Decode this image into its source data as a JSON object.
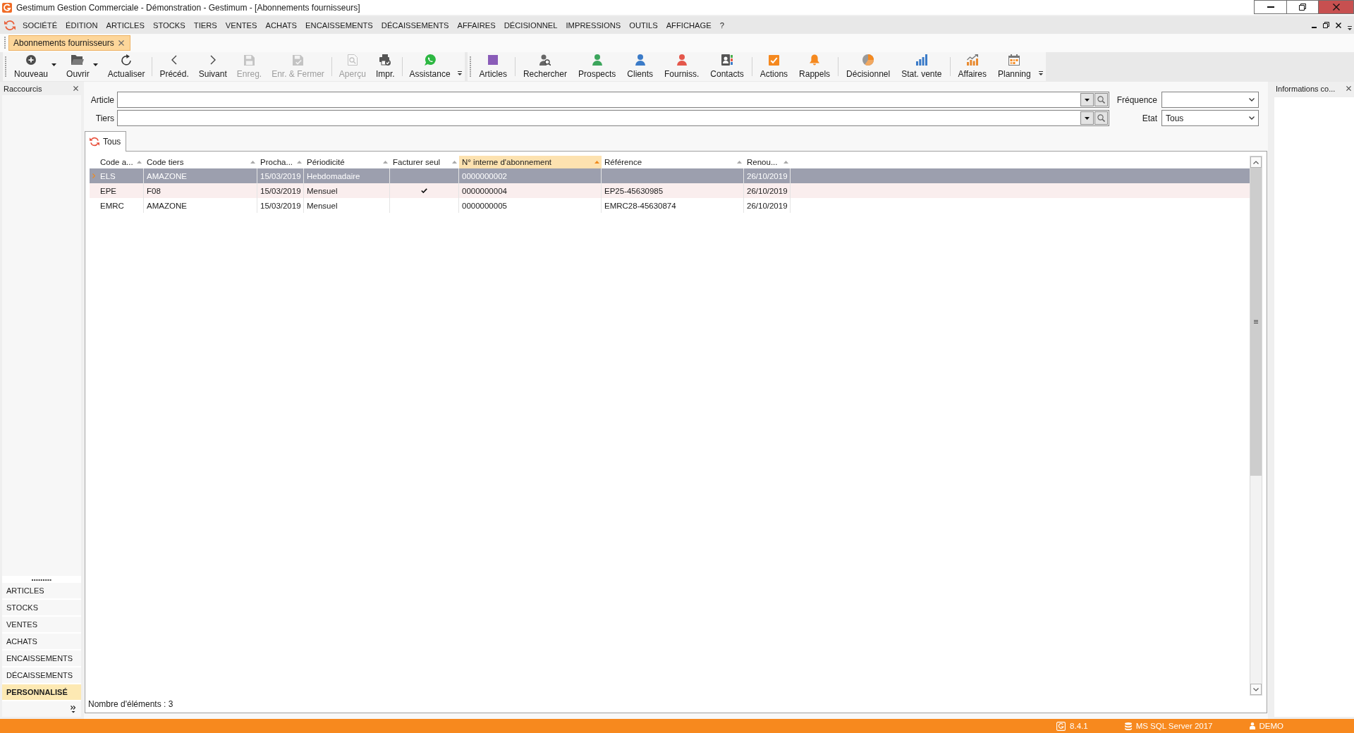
{
  "window": {
    "title": "Gestimum Gestion Commerciale - Démonstration - Gestimum - [Abonnements fournisseurs]"
  },
  "menu": [
    "SOCIÉTÉ",
    "ÉDITION",
    "ARTICLES",
    "STOCKS",
    "TIERS",
    "VENTES",
    "ACHATS",
    "ENCAISSEMENTS",
    "DÉCAISSEMENTS",
    "AFFAIRES",
    "DÉCISIONNEL",
    "IMPRESSIONS",
    "OUTILS",
    "AFFICHAGE",
    "?"
  ],
  "document_tabs": [
    {
      "label": "Abonnements fournisseurs",
      "selected": true
    }
  ],
  "toolbars": [
    {
      "groups": [
        [
          {
            "label": "Nouveau",
            "disabled": false,
            "dropdown": true
          },
          {
            "label": "Ouvrir",
            "disabled": false,
            "dropdown": true
          },
          {
            "label": "Actualiser",
            "disabled": false,
            "dropdown": false
          }
        ],
        [
          {
            "label": "Précéd.",
            "disabled": false,
            "dropdown": false
          },
          {
            "label": "Suivant",
            "disabled": false,
            "dropdown": false
          },
          {
            "label": "Enreg.",
            "disabled": true,
            "dropdown": false
          },
          {
            "label": "Enr. & Fermer",
            "disabled": true,
            "dropdown": false
          }
        ],
        [
          {
            "label": "Aperçu",
            "disabled": true,
            "dropdown": false
          },
          {
            "label": "Impr.",
            "disabled": false,
            "dropdown": false
          }
        ],
        [
          {
            "label": "Assistance",
            "disabled": false,
            "dropdown": false
          }
        ]
      ]
    },
    {
      "groups": [
        [
          {
            "label": "Articles",
            "disabled": false,
            "dropdown": false
          }
        ],
        [
          {
            "label": "Rechercher",
            "disabled": false,
            "dropdown": false
          },
          {
            "label": "Prospects",
            "disabled": false,
            "dropdown": false
          },
          {
            "label": "Clients",
            "disabled": false,
            "dropdown": false
          },
          {
            "label": "Fourniss.",
            "disabled": false,
            "dropdown": false
          },
          {
            "label": "Contacts",
            "disabled": false,
            "dropdown": false
          }
        ],
        [
          {
            "label": "Actions",
            "disabled": false,
            "dropdown": false
          },
          {
            "label": "Rappels",
            "disabled": false,
            "dropdown": false
          }
        ],
        [
          {
            "label": "Décisionnel",
            "disabled": false,
            "dropdown": false
          },
          {
            "label": "Stat. vente",
            "disabled": false,
            "dropdown": false
          }
        ],
        [
          {
            "label": "Affaires",
            "disabled": false,
            "dropdown": false
          },
          {
            "label": "Planning",
            "disabled": false,
            "dropdown": false
          }
        ]
      ]
    }
  ],
  "shortcuts": {
    "title": "Raccourcis",
    "items": [
      {
        "label": "ARTICLES",
        "selected": false
      },
      {
        "label": "STOCKS",
        "selected": false
      },
      {
        "label": "VENTES",
        "selected": false
      },
      {
        "label": "ACHATS",
        "selected": false
      },
      {
        "label": "ENCAISSEMENTS",
        "selected": false
      },
      {
        "label": "DÉCAISSEMENTS",
        "selected": false
      },
      {
        "label": "PERSONNALISÉ",
        "selected": true
      }
    ]
  },
  "filters": [
    {
      "label": "Article",
      "kind": "lookup"
    },
    {
      "label": "Fréquence",
      "kind": "select"
    },
    {
      "label": "Tiers",
      "kind": "lookup"
    },
    {
      "label": "Etat",
      "kind": "select",
      "value": "Tous"
    }
  ],
  "view_tabs": [
    {
      "label": "Tous",
      "selected": true
    }
  ],
  "table": {
    "columns": [
      {
        "label": "Code a...",
        "sorted": false
      },
      {
        "label": "Code tiers",
        "sorted": false
      },
      {
        "label": "Procha...",
        "sorted": false
      },
      {
        "label": "Périodicité",
        "sorted": false
      },
      {
        "label": "Facturer seul",
        "sorted": false
      },
      {
        "label": "N° interne d'abonnement",
        "sorted": true
      },
      {
        "label": "Référence",
        "sorted": false
      },
      {
        "label": "Renou...",
        "sorted": false
      }
    ],
    "rows": [
      {
        "selected": true,
        "hovered": false,
        "column_1": "ELS",
        "code_tiers": "AMAZONE",
        "column_3": "15/03/2019",
        "periodicite": "Hebdomadaire",
        "facturer_seul": false,
        "numero_interne": "0000000002",
        "column_8": "26/10/2019"
      },
      {
        "selected": false,
        "hovered": true,
        "column_1": "EPE",
        "code_tiers": "F08",
        "column_3": "15/03/2019",
        "periodicite": "Mensuel",
        "facturer_seul": true,
        "numero_interne": "0000000004",
        "reference": "EP25-45630985",
        "column_8": "26/10/2019"
      },
      {
        "selected": false,
        "hovered": false,
        "column_1": "EMRC",
        "code_tiers": "AMAZONE",
        "column_3": "15/03/2019",
        "periodicite": "Mensuel",
        "facturer_seul": false,
        "numero_interne": "0000000005",
        "reference": "EMRC28-45630874",
        "column_8": "26/10/2019"
      }
    ],
    "count": "Nombre d'éléments : 3"
  },
  "info_panel": {
    "title": "Informations co..."
  },
  "status_bar": {
    "version": "8.4.1",
    "database": "MS SQL Server 2017",
    "user": "DEMO"
  }
}
